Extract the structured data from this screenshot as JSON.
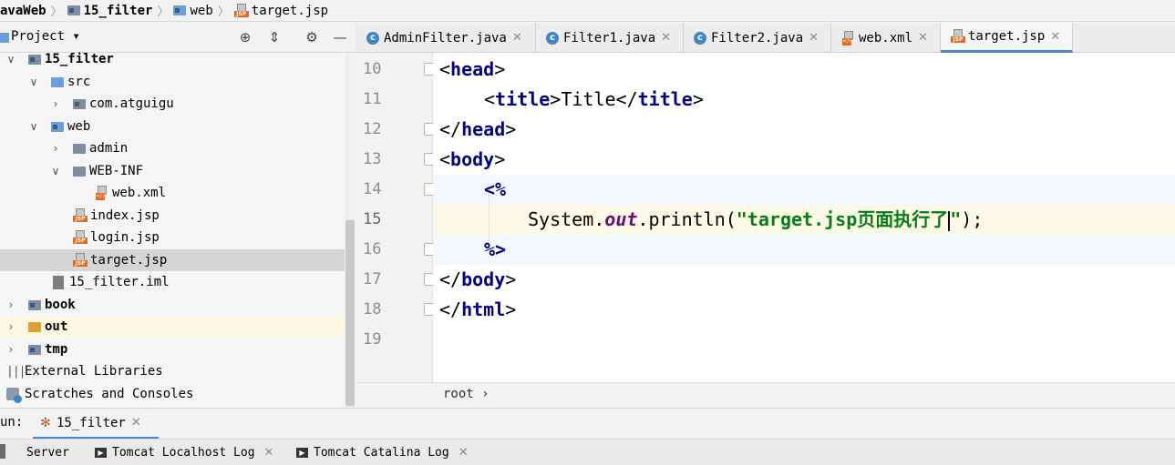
{
  "breadcrumb": {
    "items": [
      "avaWeb",
      "15_filter",
      "web",
      "target.jsp"
    ]
  },
  "project_panel": {
    "title": "Project ▾",
    "tree": [
      {
        "label": "15_filter",
        "bold": true
      },
      {
        "label": "src"
      },
      {
        "label": "com.atguigu"
      },
      {
        "label": "web"
      },
      {
        "label": "admin"
      },
      {
        "label": "WEB-INF"
      },
      {
        "label": "web.xml"
      },
      {
        "label": "index.jsp"
      },
      {
        "label": "login.jsp"
      },
      {
        "label": "target.jsp"
      },
      {
        "label": "15_filter.iml"
      },
      {
        "label": "book",
        "bold": true
      },
      {
        "label": "out",
        "bold": true
      },
      {
        "label": "tmp",
        "bold": true
      },
      {
        "label": "External Libraries"
      },
      {
        "label": "Scratches and Consoles"
      }
    ]
  },
  "tabs": [
    {
      "label": "AdminFilter.java"
    },
    {
      "label": "Filter1.java"
    },
    {
      "label": "Filter2.java"
    },
    {
      "label": "web.xml"
    },
    {
      "label": "target.jsp",
      "active": true
    }
  ],
  "editor": {
    "line_numbers": [
      "10",
      "11",
      "12",
      "13",
      "14",
      "15",
      "16",
      "17",
      "18",
      "19"
    ],
    "lines": {
      "l10": {
        "open": "<",
        "tag": "head",
        "close": ">"
      },
      "l11": {
        "open1": "<",
        "tag1": "title",
        "close1": ">",
        "text": "Title",
        "open2": "</",
        "tag2": "title",
        "close2": ">"
      },
      "l12": {
        "open": "</",
        "tag": "head",
        "close": ">"
      },
      "l13": {
        "open": "<",
        "tag": "body",
        "close": ">"
      },
      "l14": {
        "delim": "<%"
      },
      "l15": {
        "obj": "System.",
        "field": "out",
        "call": ".println(",
        "string": "\"target.jsp页面执行了",
        "string_end": "\"",
        "end": ");"
      },
      "l16": {
        "delim": "%>"
      },
      "l17": {
        "open": "</",
        "tag": "body",
        "close": ">"
      },
      "l18": {
        "open": "</",
        "tag": "html",
        "close": ">"
      }
    },
    "breadcrumb": "root  ›"
  },
  "run": {
    "prefix": "un:",
    "config": "15_filter",
    "tabs": [
      "Server",
      "Tomcat Localhost Log",
      "Tomcat Catalina Log"
    ]
  },
  "colors": {
    "tag": "#000080",
    "string": "#067d17",
    "field": "#660e7a",
    "current_line": "#fcf9e6",
    "selection": "#d5d5d5",
    "accent": "#4a88c7"
  }
}
